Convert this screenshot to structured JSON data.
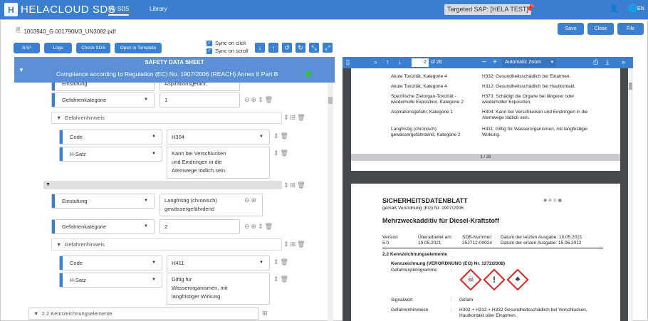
{
  "app": {
    "logo_letter": "H",
    "name": "HELACLOUD SDS"
  },
  "nav": {
    "my_sds": "My SDS",
    "library": "Library"
  },
  "topbar": {
    "targeted": "Targeted SAP: [HELA TEST]",
    "lang": "EN"
  },
  "file": {
    "name": "1003940_G 001790M3_UN3082.pdf"
  },
  "actions": {
    "save": "Save",
    "close": "Close",
    "file": "File"
  },
  "toolbar": {
    "sap": "SAP",
    "logs": "Logs",
    "check": "Check SDS",
    "open_template": "Open in Template",
    "sync_click": "Sync on click",
    "sync_scroll": "Sync on scroll"
  },
  "sds": {
    "title": "SAFETY DATA SHEET",
    "subtitle": "Compliance according to Regulation (EC) No. 1907/2006 (REACH) Annex II Part B"
  },
  "form": {
    "top_partial_label": "Einstufung",
    "top_partial_value": "Aspirationsgefahr,",
    "r1_label": "Gefahrenkategorie",
    "r1_value": "1",
    "g1_label": "Gefahrenhinweis",
    "g1_code_label": "Code",
    "g1_code_value": "H304",
    "g1_hsatz_label": "H-Satz",
    "g1_hsatz_value": "Kann bei Verschlucken\nund Eindringen in die\nAtemwege tödlich sein.",
    "e2_label": "Einstufung",
    "e2_value": "Langfristig (chronisch)\ngewässergefährdend",
    "r2_label": "Gefahrenkategorie",
    "r2_value": "2",
    "g2_label": "Gefahrenhinweis",
    "g2_code_label": "Code",
    "g2_code_value": "H411",
    "g2_hsatz_label": "H-Satz",
    "g2_hsatz_value": "Giftig für\nWasserorganismen, mit\nlangfristiger Wirkung.",
    "section_label": "2.2 Kennzeichnungselemente"
  },
  "pdf": {
    "page_num": "2",
    "page_of": "of 28",
    "zoom": "Automatic Zoom",
    "p1_rows": [
      {
        "l": "Akute Toxizität, Kategorie 4",
        "r": "H332: Gesundheitsschädlich bei Einatmen."
      },
      {
        "l": "Akute Toxizität, Kategorie 4",
        "r": "H312: Gesundheitsschädlich bei Hautkontakt."
      },
      {
        "l": "Spezifische Zielorgan-Toxizität - wiederholte Exposition, Kategorie 2",
        "r": "H373: Schädigt die Organe bei längerer oder wiederholter Exposition."
      },
      {
        "l": "Aspirationsgefahr, Kategorie 1",
        "r": "H304: Kann bei Verschlucken und Eindringen in die Atemwege tödlich sein."
      },
      {
        "l": "Langfristig (chronisch) gewässergefährdend, Kategorie 2",
        "r": "H411: Giftig für Wasserorganismen, mit langfristiger Wirkung."
      }
    ],
    "p1_footer": "1 / 28",
    "p2_title": "SICHERHEITSDATENBLATT",
    "p2_reg": "gemäß Verordnung (EG) Nr. 1907/2006",
    "p2_product": "Mehrzweckadditiv für Diesel-Kraftstoff",
    "p2_ver_l": "Version",
    "p2_ver_v": "5.0",
    "p2_upd_l": "Überarbeitet am:",
    "p2_upd_v": "10.05.2021",
    "p2_sdb_l": "SDB-Nummer:",
    "p2_sdb_v": "252712-00024",
    "p2_last": "Datum der letzten Ausgabe: 10.05.2021",
    "p2_first": "Datum der ersten Ausgabe: 15.06.2012",
    "p2_sec": "2.2 Kennzeichnungselemente",
    "p2_kz": "Kennzeichnung (VERORDNUNG (EG) Nr. 1272/2008)",
    "p2_pikto": "Gefahrenpiktogramme",
    "p2_sig_l": "Signalwort",
    "p2_sig_v": "Gefahr",
    "p2_gh_l": "Gefahrenhinweise",
    "p2_gh_v": "H302 + H312 + H332   Gesundheitsschädlich bei Verschlucken, Hautkontakt oder Einatmen."
  },
  "colors": {
    "primary": "#3b7fd0",
    "ok": "#2ec22e"
  }
}
